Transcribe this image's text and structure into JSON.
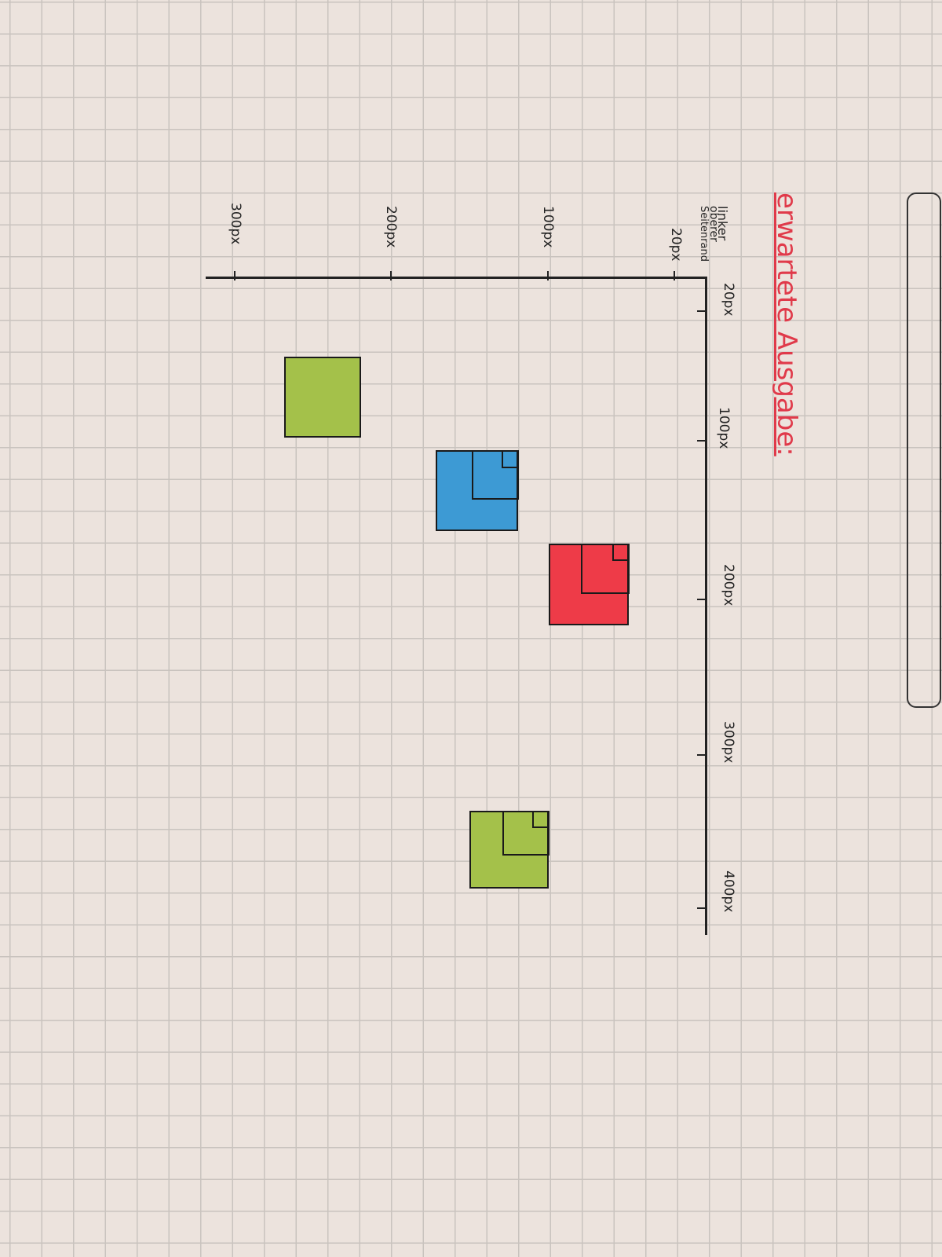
{
  "title": "erwartete Ausgabe:",
  "origin_label": [
    "linker",
    "oberer",
    "Seitenrand"
  ],
  "horizontal_axis": {
    "ticks": [
      "20px",
      "100px",
      "200px",
      "300px",
      "400px"
    ]
  },
  "vertical_axis": {
    "ticks": [
      "20px",
      "100px",
      "200px",
      "300px"
    ]
  },
  "colors": {
    "title": "#e03a4a",
    "green": "#a4c14a",
    "blue": "#3d9ad4",
    "red": "#ee3b48",
    "ink": "#1a1a1a"
  },
  "squares": [
    {
      "color": "green",
      "nested": false
    },
    {
      "color": "blue",
      "nested": true
    },
    {
      "color": "red",
      "nested": true
    },
    {
      "color": "green",
      "nested": true
    }
  ]
}
